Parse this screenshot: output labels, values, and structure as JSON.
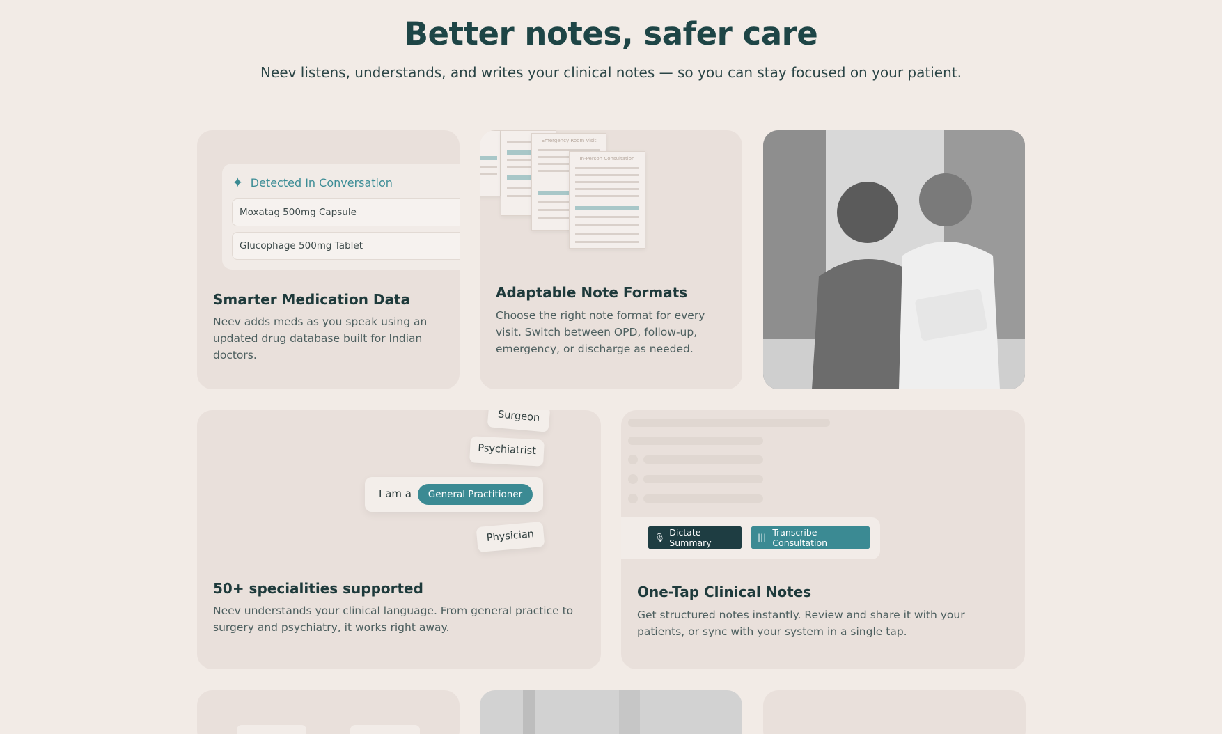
{
  "hero": {
    "title": "Better notes, safer care",
    "subtitle": "Neev listens, understands, and writes your clinical notes — so you can stay focused on your patient."
  },
  "cards": {
    "medication": {
      "panel_title": "Detected In Conversation",
      "items": [
        "Moxatag 500mg Capsule",
        "Glucophage 500mg Tablet"
      ],
      "title": "Smarter Medication Data",
      "description": "Neev adds meds as you speak using an updated drug database built for Indian doctors."
    },
    "formats": {
      "doc_titles": [
        "Emergency Room Visit",
        "In-Person Consultation"
      ],
      "title": "Adaptable Note Formats",
      "description": "Choose the right note format for every visit. Switch between OPD, follow-up, emergency, or discharge as needed."
    },
    "specialities": {
      "pills": [
        "Surgeon",
        "Psychiatrist",
        "Physician"
      ],
      "iam_label": "I am a",
      "selected": "General Practitioner",
      "title": "50+ specialities supported",
      "description": "Neev understands your clinical language. From general practice to surgery and psychiatry, it works right away."
    },
    "onetap": {
      "dictate_label": "Dictate Summary",
      "transcribe_label": "Transcribe Consultation",
      "title": "One-Tap Clinical Notes",
      "description": "Get structured notes instantly. Review and share it with your patients, or sync with your system in a single tap."
    }
  },
  "colors": {
    "background": "#f2ebe6",
    "card": "#e9e0db",
    "accent": "#3b8a93",
    "dark": "#1e3d42",
    "title": "#1e4546"
  }
}
